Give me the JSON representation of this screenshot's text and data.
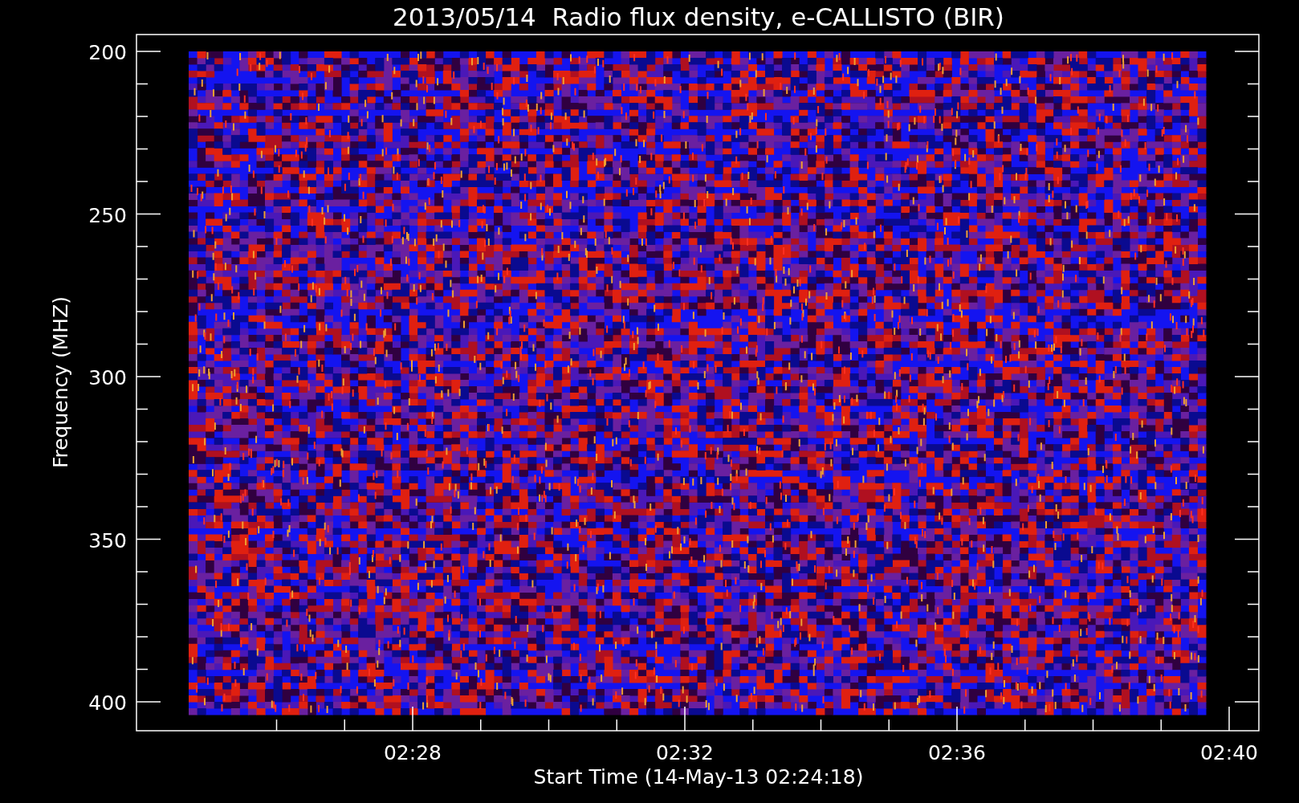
{
  "title": "2013/05/14  Radio flux density, e-CALLISTO (BIR)",
  "y_axis": {
    "label": "Frequency (MHZ)",
    "ticks": [
      "200",
      "250",
      "300",
      "350",
      "400"
    ]
  },
  "x_axis": {
    "label": "Start Time (14-May-13 02:24:18)",
    "ticks": [
      "02:28",
      "02:32",
      "02:36",
      "02:40"
    ]
  }
}
